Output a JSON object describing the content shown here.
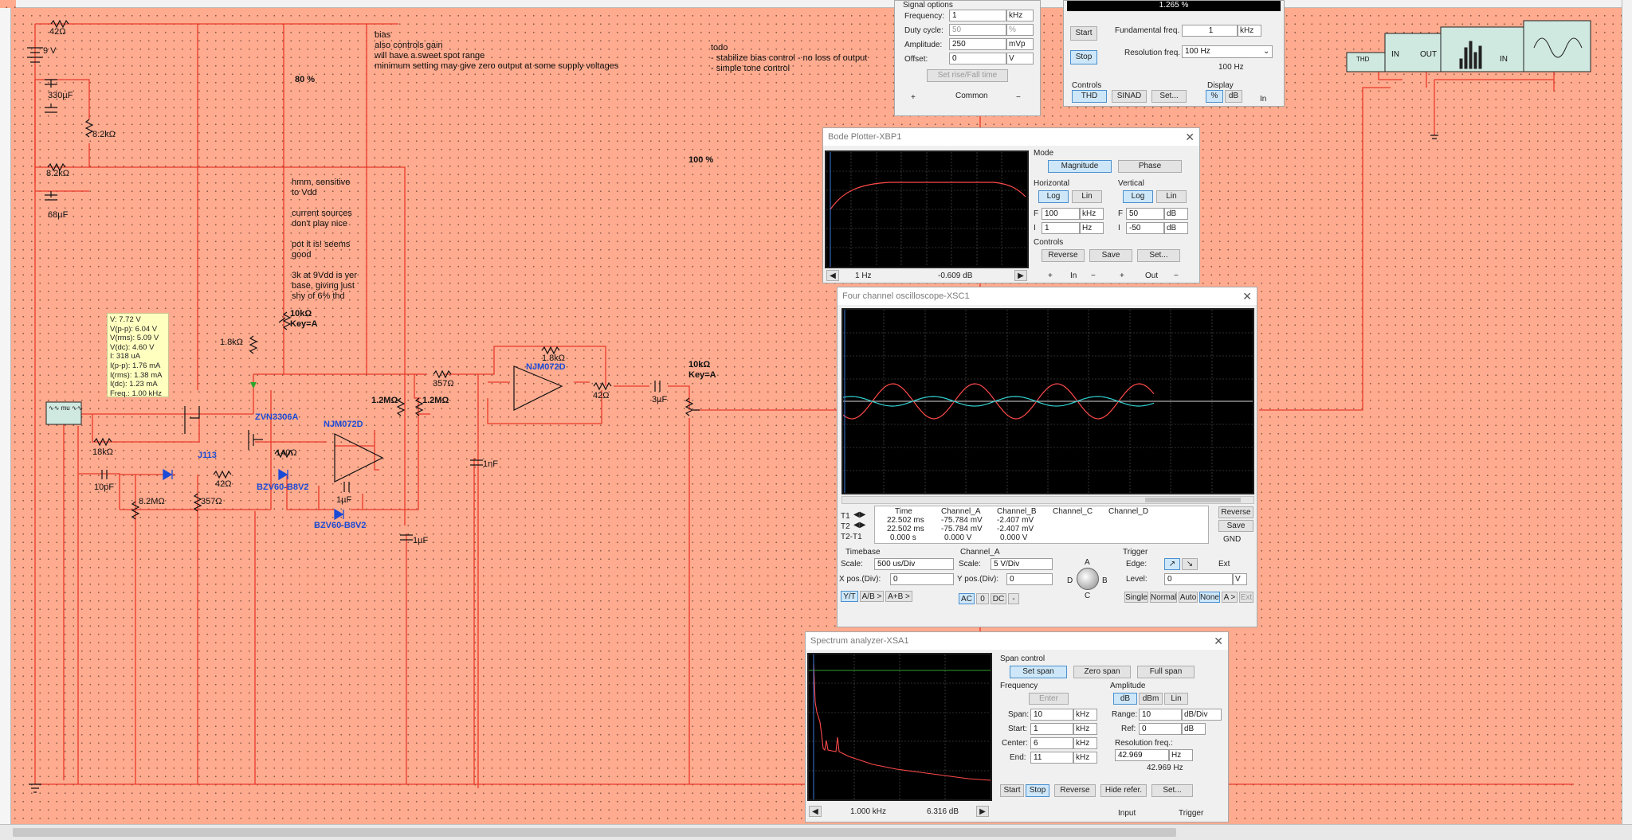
{
  "colors": {
    "canvas": "#ffab8f",
    "wire": "#e8392a",
    "component": "#111111",
    "accent_blue": "#1a4bd6",
    "scope_bg": "#000000",
    "trace_red": "#ff4a4a",
    "trace_cyan": "#33d1d1"
  },
  "schematic": {
    "labels": {
      "r42_top": "42Ω",
      "v9": "9 V",
      "c330": "330µF",
      "r8k2_a": "8.2kΩ",
      "r8k2_b": "8.2kΩ",
      "c68": "68µF",
      "r1k8_a": "1.8kΩ",
      "pot10k_a_val": "10kΩ",
      "pot10k_a_key": "Key=A",
      "pct80": "80 %",
      "pct100": "100 %",
      "r18k": "18kΩ",
      "c10p": "10pF",
      "r8m2": "8.2MΩ",
      "r357_a": "357Ω",
      "r42_b": "42Ω",
      "j113": "J113",
      "zvn": "ZVN3306A",
      "r140": "140Ω",
      "bzv_a": "BZV60-B8V2",
      "bzv_b": "BZV60-B8V2",
      "c1u_a": "1µF",
      "c1u_b": "1µF",
      "njm_a": "NJM072D",
      "njm_b": "NJM072D",
      "r1m2_a": "1.2MΩ",
      "r1m2_b": "1.2MΩ",
      "r357_b": "357Ω",
      "c1n": "1nF",
      "r1k8_b": "1.8kΩ",
      "r42_c": "42Ω",
      "c3u": "3µF",
      "pot10k_b_val": "10kΩ",
      "pot10k_b_key": "Key=A",
      "xfg_label": "∿∿ mu ∿∿",
      "thd_tag": "THD",
      "in_tag": "IN",
      "out_tag": "OUT",
      "in_tag2": "IN"
    },
    "notes": {
      "bias": "bias\nalso controls gain\nwill have a sweet spot range\nminimum setting may give zero output at some supply voltages",
      "todo": "todo\n- stabilize bias control - no loss of output\n- simple tone control",
      "hmm": "hmm, sensitive\nto Vdd\n\ncurrent sources\ndon't play nice\n\npot it is! seems\ngood\n\n3k at 9Vdd is yer\nbase, giving just\nshy of 6% thd"
    },
    "probe": [
      "V: 7.72 V",
      "V(p-p): 6.04 V",
      "V(rms): 5.09 V",
      "V(dc): 4.60 V",
      "I: 318 uA",
      "I(p-p): 1.76 mA",
      "I(rms): 1.38 mA",
      "I(dc): 1.23 mA",
      "Freq.: 1.00 kHz"
    ]
  },
  "signal_options": {
    "title": "Signal options",
    "rows": [
      {
        "label": "Frequency:",
        "value": "1",
        "unit": "kHz"
      },
      {
        "label": "Duty cycle:",
        "value": "50",
        "unit": "%"
      },
      {
        "label": "Amplitude:",
        "value": "250",
        "unit": "mVp"
      },
      {
        "label": "Offset:",
        "value": "0",
        "unit": "V"
      }
    ],
    "set_rise_fall": "Set rise/Fall time",
    "plus": "+",
    "common": "Common",
    "minus": "−"
  },
  "thd": {
    "reading": "1.265 %",
    "start": "Start",
    "stop": "Stop",
    "fund_label": "Fundamental freq.",
    "fund_value": "1",
    "fund_unit": "kHz",
    "res_label": "Resolution freq.",
    "res_value": "100 Hz",
    "res_display": "100 Hz",
    "controls_label": "Controls",
    "display_label": "Display",
    "btn_thd": "THD",
    "btn_sinad": "SINAD",
    "btn_set": "Set...",
    "btn_pct": "%",
    "btn_db": "dB",
    "in": "In"
  },
  "bode": {
    "title": "Bode Plotter-XBP1",
    "mode_label": "Mode",
    "magnitude": "Magnitude",
    "phase": "Phase",
    "horizontal": "Horizontal",
    "vertical": "Vertical",
    "log": "Log",
    "lin": "Lin",
    "h_f": "100",
    "h_f_unit": "kHz",
    "h_i": "1",
    "h_i_unit": "Hz",
    "v_f": "50",
    "v_f_unit": "dB",
    "v_i": "-50",
    "v_i_unit": "dB",
    "f_label": "F",
    "i_label": "I",
    "controls_label": "Controls",
    "reverse": "Reverse",
    "save": "Save",
    "set": "Set...",
    "cursor_freq": "1 Hz",
    "cursor_db": "-0.609 dB",
    "in_label": "In",
    "out_label": "Out",
    "plus": "+",
    "minus": "−"
  },
  "scope": {
    "title": "Four channel oscilloscope-XSC1",
    "headers": [
      "Time",
      "Channel_A",
      "Channel_B",
      "Channel_C",
      "Channel_D"
    ],
    "rows": [
      {
        "label": "T1",
        "time": "22.502 ms",
        "a": "-75.784 mV",
        "b": "-2.407 mV"
      },
      {
        "label": "T2",
        "time": "22.502 ms",
        "a": "-75.784 mV",
        "b": "-2.407 mV"
      },
      {
        "label": "T2-T1",
        "time": "0.000 s",
        "a": "0.000 V",
        "b": "0.000 V"
      }
    ],
    "reverse": "Reverse",
    "save": "Save",
    "gnd": "GND",
    "timebase_label": "Timebase",
    "scale_label": "Scale:",
    "timebase_scale": "500 us/Div",
    "xpos_label": "X pos.(Div):",
    "xpos": "0",
    "yt": "Y/T",
    "ab": "A/B >",
    "apb": "A+B >",
    "channel_label": "Channel_A",
    "ch_scale": "5  V/Div",
    "ypos_label": "Y pos.(Div):",
    "ypos": "0",
    "ac": "AC",
    "zero": "0",
    "dc": "DC",
    "minus": "-",
    "knob_a": "A",
    "knob_b": "B",
    "knob_c": "C",
    "knob_d": "D",
    "trigger_label": "Trigger",
    "edge_label": "Edge:",
    "level_label": "Level:",
    "level": "0",
    "level_unit": "V",
    "ext": "Ext",
    "single": "Single",
    "normal": "Normal",
    "auto": "Auto",
    "none": "None",
    "a_gt": "A >",
    "ext_btn": "Ext"
  },
  "spectrum": {
    "title": "Spectrum analyzer-XSA1",
    "span_control": "Span control",
    "set_span": "Set span",
    "zero_span": "Zero span",
    "full_span": "Full span",
    "frequency_label": "Frequency",
    "enter": "Enter",
    "freq_rows": [
      {
        "label": "Span:",
        "value": "10",
        "unit": "kHz"
      },
      {
        "label": "Start:",
        "value": "1",
        "unit": "kHz"
      },
      {
        "label": "Center:",
        "value": "6",
        "unit": "kHz"
      },
      {
        "label": "End:",
        "value": "11",
        "unit": "kHz"
      }
    ],
    "amplitude_label": "Amplitude",
    "db": "dB",
    "dbm": "dBm",
    "lin": "Lin",
    "range_label": "Range:",
    "range": "10",
    "range_unit": "dB/Div",
    "ref_label": "Ref:",
    "ref": "0",
    "ref_unit": "dB",
    "res_label": "Resolution freq.:",
    "res_value": "42.969",
    "res_unit": "Hz",
    "res_display": "42.969  Hz",
    "start": "Start",
    "stop": "Stop",
    "reverse": "Reverse",
    "hide_ref": "Hide refer.",
    "set": "Set...",
    "input": "Input",
    "trigger": "Trigger",
    "cursor_freq": "1.000 kHz",
    "cursor_db": "6.316  dB"
  }
}
